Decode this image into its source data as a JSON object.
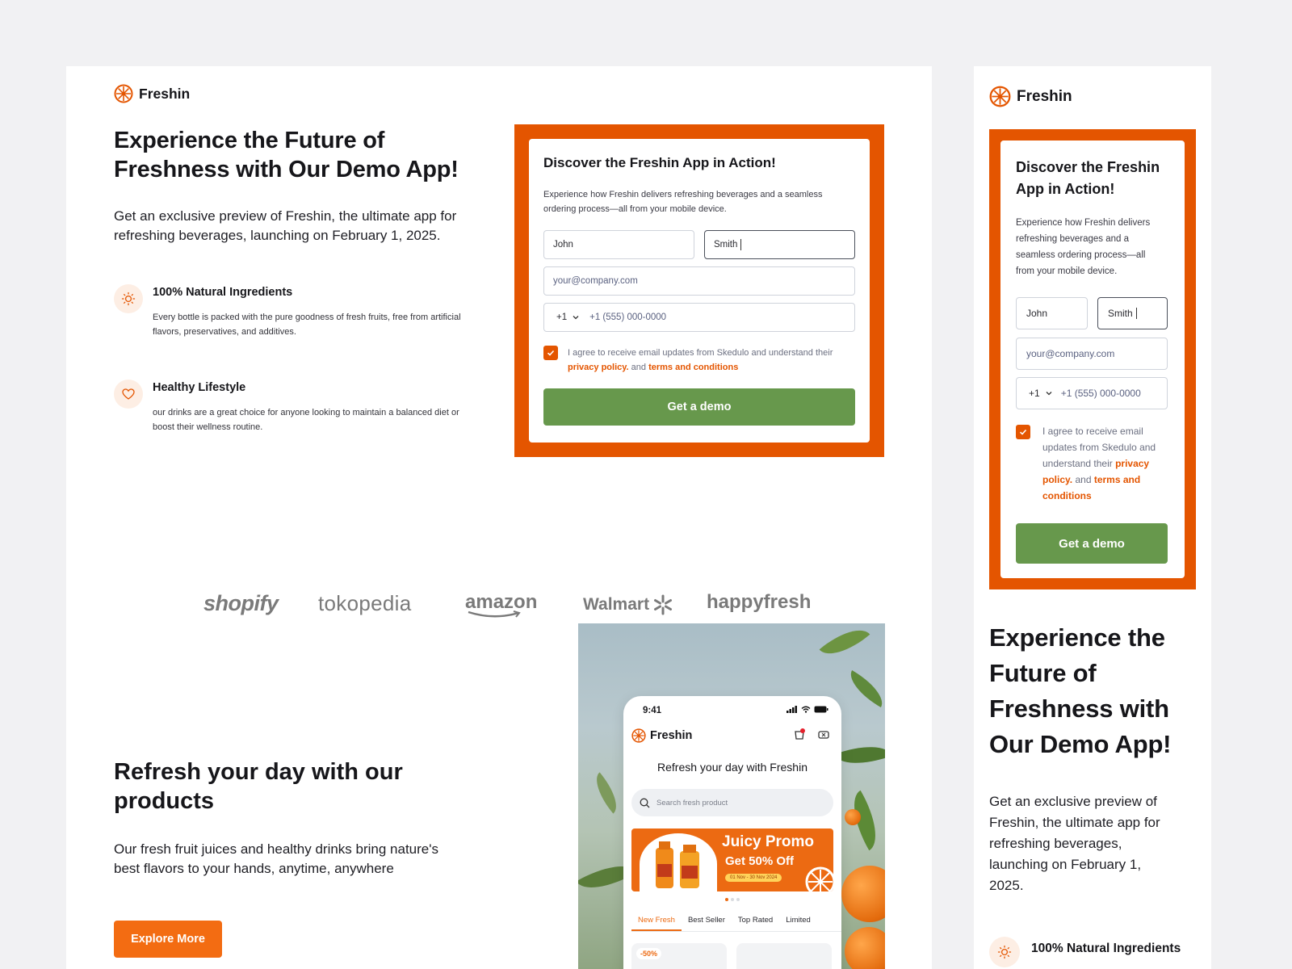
{
  "brand": {
    "name": "Freshin",
    "accent": "#e45500",
    "cta_green": "#67984c",
    "button_orange": "#f36c12"
  },
  "hero": {
    "title_line1": "Experience the Future of",
    "title_line2": "Freshness with Our Demo App!",
    "mobile_title_lines": [
      "Experience the",
      "Future of",
      "Freshness with",
      "Our Demo App!"
    ],
    "subtitle_line1": "Get an exclusive preview of Freshin, the ultimate app for",
    "subtitle_line2": "refreshing beverages, launching on February 1, 2025.",
    "mobile_subtitle_lines": [
      "Get an exclusive preview of",
      "Freshin, the ultimate app for",
      "refreshing beverages,",
      "launching on February 1,",
      "2025."
    ]
  },
  "features": [
    {
      "icon": "sun-icon",
      "title": "100% Natural Ingredients",
      "desc_line1": "Every bottle is packed with the pure goodness of fresh fruits, free from artificial",
      "desc_line2": "flavors, preservatives, and additives."
    },
    {
      "icon": "heart-icon",
      "title": "Healthy Lifestyle",
      "desc_line1": "our drinks are a great choice for anyone looking to maintain a balanced diet or",
      "desc_line2": "boost their wellness routine."
    }
  ],
  "form": {
    "title": "Discover the Freshin App in Action!",
    "mobile_title_lines": [
      "Discover the Freshin",
      "App in Action!"
    ],
    "desc_line1": "Experience how Freshin delivers refreshing beverages and a seamless",
    "desc_line2": "ordering process—all from your mobile device.",
    "mobile_desc_lines": [
      "Experience how Freshin delivers",
      "refreshing beverages and a",
      "seamless ordering process—all",
      "from your mobile device."
    ],
    "first_name": "John",
    "last_name": "Smith",
    "email_placeholder": "your@company.com",
    "country_code": "+1",
    "phone_placeholder": "+1 (555) 000-0000",
    "consent_text": "I agree to receive email updates from Skedulo and understand their",
    "consent_mobile_lines": [
      "I agree to receive email",
      "updates from Skedulo and",
      "understand their"
    ],
    "privacy_link": "privacy policy.",
    "and_word": "and",
    "terms_link": "terms and conditions",
    "checked": true,
    "submit_label": "Get a demo"
  },
  "partners": [
    "shopify",
    "tokopedia",
    "amazon",
    "Walmart",
    "happyfresh"
  ],
  "products_section": {
    "title_line1": "Refresh your day with our",
    "title_line2": "products",
    "subtitle_line1": "Our fresh fruit juices and healthy drinks bring nature's",
    "subtitle_line2": "best flavors to your hands, anytime, anywhere",
    "button_label": "Explore More"
  },
  "phone_app": {
    "time": "9:41",
    "app_name": "Freshin",
    "heading": "Refresh your day with Freshin",
    "search_placeholder": "Search fresh product",
    "promo_title": "Juicy Promo",
    "promo_subtitle": "Get 50% Off",
    "promo_dates": "01 Nov - 30 Nov 2024",
    "tabs": [
      "New Fresh",
      "Best Seller",
      "Top Rated",
      "Limited"
    ],
    "active_tab": "New Fresh",
    "card_badge": "-50%"
  }
}
